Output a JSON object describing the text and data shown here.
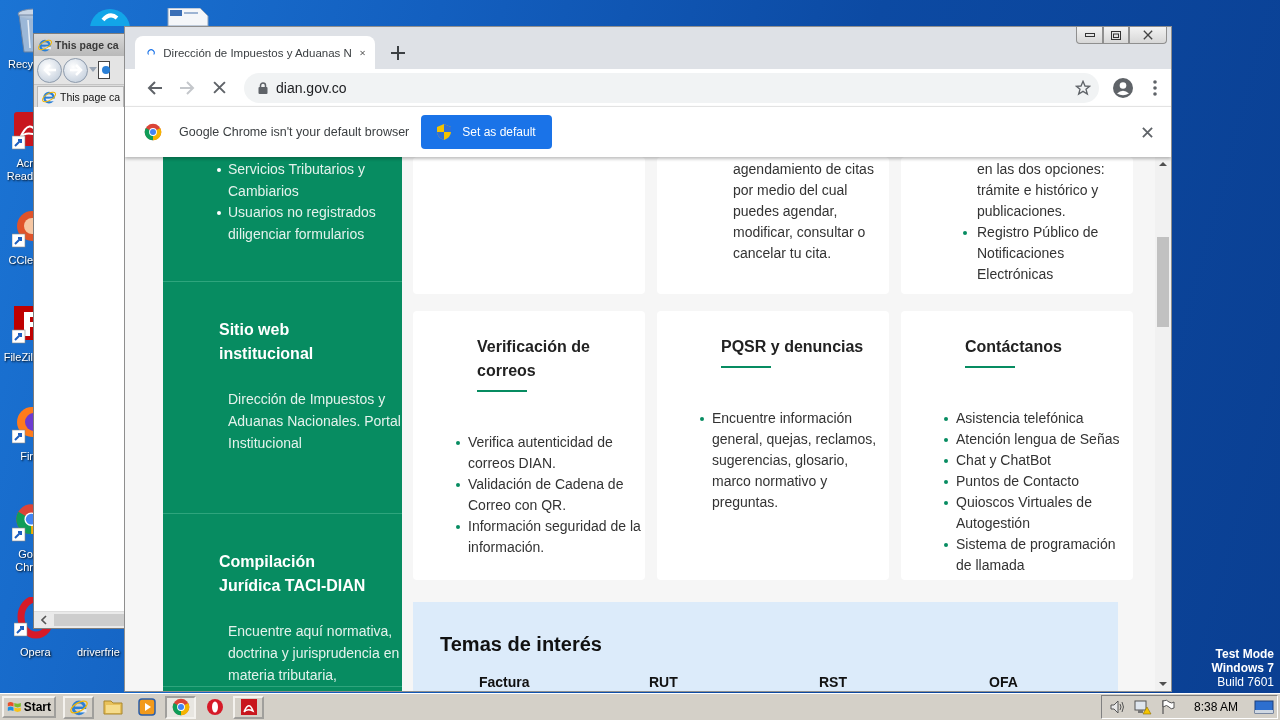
{
  "desktop": {
    "icons": [
      {
        "kind": "recycle-bin",
        "label": [
          "Recy"
        ]
      },
      {
        "kind": "skype"
      },
      {
        "kind": "document"
      },
      {
        "kind": "acrobat",
        "label": [
          "Acr",
          "Read"
        ]
      },
      {
        "kind": "ccleaner",
        "label": [
          "CCle"
        ]
      },
      {
        "kind": "filezilla",
        "label": [
          "FileZil"
        ]
      },
      {
        "kind": "firefox",
        "label": [
          "Fir"
        ]
      },
      {
        "kind": "chrome",
        "label": [
          "Go",
          "Chr"
        ]
      },
      {
        "kind": "opera",
        "label": [
          "Opera"
        ]
      },
      {
        "kind": "covered",
        "label": [
          "driverfrie"
        ]
      }
    ],
    "notice": [
      "Test Mode",
      "Windows 7",
      "Build 7601"
    ]
  },
  "ie_window": {
    "title": "This page ca",
    "tab": "This page ca"
  },
  "browser": {
    "tab": {
      "title": "Dirección de Impuestos y Aduanas N",
      "loading": true
    },
    "address": "dian.gov.co",
    "forward_disabled": true,
    "infobar": {
      "message": "Google Chrome isn't your default browser",
      "button": "Set as default"
    }
  },
  "page": {
    "sidebar": [
      {
        "bullets": [
          "Servicios Tributarios y Cambiarios",
          "Usuarios no registrados diligenciar formularios"
        ]
      },
      {
        "title": "Sitio web institucional",
        "text": "Dirección de Impuestos y Aduanas Nacionales. Portal Institucional"
      },
      {
        "title": "Compilación Jurídica TACI-DIAN",
        "text": "Encuentre aquí normativa, doctrina y jurisprudencia en materia tributaria,"
      }
    ],
    "cards_top": [
      {
        "kind": "empty"
      },
      {
        "kind": "paragraph",
        "paragraph": "agendamiento de citas por medio del cual puedes agendar, modificar, consultar o cancelar tu cita."
      },
      {
        "kind": "list",
        "items": [
          {
            "kind": "continuation",
            "text": "en las dos opciones: trámite e histórico y publicaciones."
          },
          {
            "kind": "bullet",
            "text": "Registro Público de Notificaciones Electrónicas"
          }
        ]
      }
    ],
    "cards": [
      {
        "title": "Verificación de correos",
        "items": [
          "Verifica autenticidad de correos DIAN.",
          "Validación de Cadena de Correo con QR.",
          "Información seguridad de la información."
        ]
      },
      {
        "title": "PQSR y denuncias",
        "items": [
          "Encuentre información general, quejas, reclamos, sugerencias, glosario, marco normativo y preguntas."
        ]
      },
      {
        "title": "Contáctanos",
        "items": [
          "Asistencia telefónica",
          "Atención lengua de Señas",
          "Chat y ChatBot",
          "Puntos de Contacto",
          "Quioscos Virtuales de Autogestión",
          "Sistema de programación de llamada"
        ]
      }
    ],
    "topics_panel": {
      "title": "Temas de interés",
      "topics": [
        "Factura",
        "RUT",
        "RST",
        "OFA"
      ]
    }
  },
  "taskbar": {
    "start": "Start",
    "items": [
      {
        "kind": "ie",
        "running": true,
        "active": false
      },
      {
        "kind": "folder",
        "running": false,
        "active": false
      },
      {
        "kind": "media",
        "running": false,
        "active": false
      },
      {
        "kind": "chrome",
        "running": true,
        "active": true
      },
      {
        "kind": "opera",
        "running": false,
        "active": false
      },
      {
        "kind": "acrobat",
        "running": true,
        "active": false
      }
    ],
    "clock": "8:38 AM"
  }
}
